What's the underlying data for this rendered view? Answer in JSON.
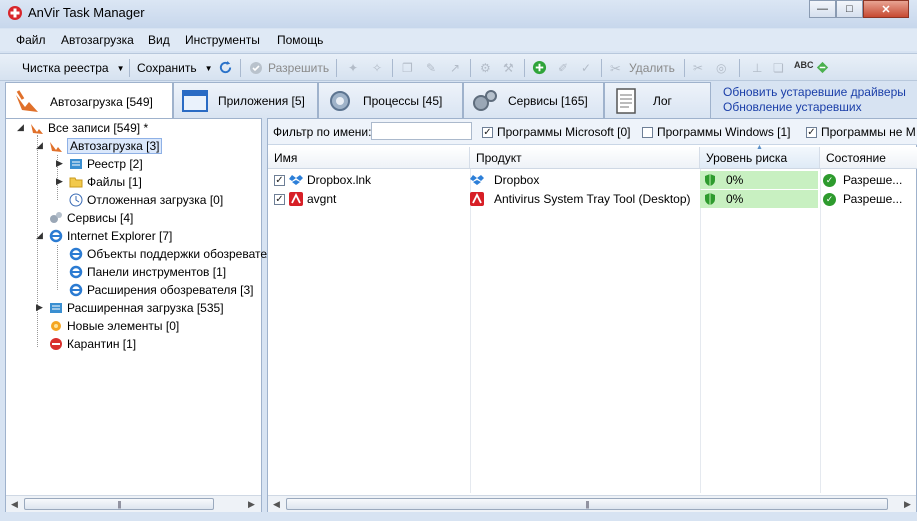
{
  "window": {
    "title": "AnVir Task Manager",
    "controls": {
      "minimize": "—",
      "maximize": "□",
      "close": "✕"
    }
  },
  "menu": [
    "Файл",
    "Автозагрузка",
    "Вид",
    "Инструменты",
    "Помощь"
  ],
  "toolbar": {
    "clean_registry": "Чистка реестра",
    "save": "Сохранить",
    "allow": "Разрешить",
    "delete": "Удалить"
  },
  "tabs": [
    {
      "label": "Автозагрузка [549]",
      "active": true
    },
    {
      "label": "Приложения [5]"
    },
    {
      "label": "Процессы [45]"
    },
    {
      "label": "Сервисы [165]"
    },
    {
      "label": "Лог"
    }
  ],
  "links": [
    "Обновить устаревшие драйверы",
    "Обновление устаревших"
  ],
  "tree": [
    {
      "label": "Все записи [549] *"
    },
    {
      "label": "Автозагрузка [3]",
      "selected": true
    },
    {
      "label": "Реестр [2]"
    },
    {
      "label": "Файлы [1]"
    },
    {
      "label": "Отложенная загрузка [0]"
    },
    {
      "label": "Сервисы [4]"
    },
    {
      "label": "Internet Explorer [7]"
    },
    {
      "label": "Объекты поддержки обозревателя"
    },
    {
      "label": "Панели инструментов [1]"
    },
    {
      "label": "Расширения обозревателя [3]"
    },
    {
      "label": "Расширенная загрузка [535]"
    },
    {
      "label": "Новые элементы [0]"
    },
    {
      "label": "Карантин [1]"
    }
  ],
  "filter": {
    "label": "Фильтр по имени:",
    "value": "",
    "checkboxes": [
      {
        "label": "Программы Microsoft [0]",
        "checked": true
      },
      {
        "label": "Программы Windows [1]",
        "checked": false
      },
      {
        "label": "Программы не М",
        "checked": true
      }
    ]
  },
  "table": {
    "columns": [
      "Имя",
      "Продукт",
      "Уровень риска",
      "Состояние"
    ],
    "rows": [
      {
        "checked": true,
        "name": "Dropbox.lnk",
        "product": "Dropbox",
        "risk": "0%",
        "state": "Разреше...",
        "icon": "dropbox-icon"
      },
      {
        "checked": true,
        "name": "avgnt",
        "product": "Antivirus System Tray Tool (Desktop)",
        "risk": "0%",
        "state": "Разреше...",
        "icon": "avira-icon"
      }
    ]
  },
  "colors": {
    "accent_link": "#1a3ea8",
    "risk_bg": "#c8f0c1",
    "ok_green": "#2e9b2e"
  }
}
